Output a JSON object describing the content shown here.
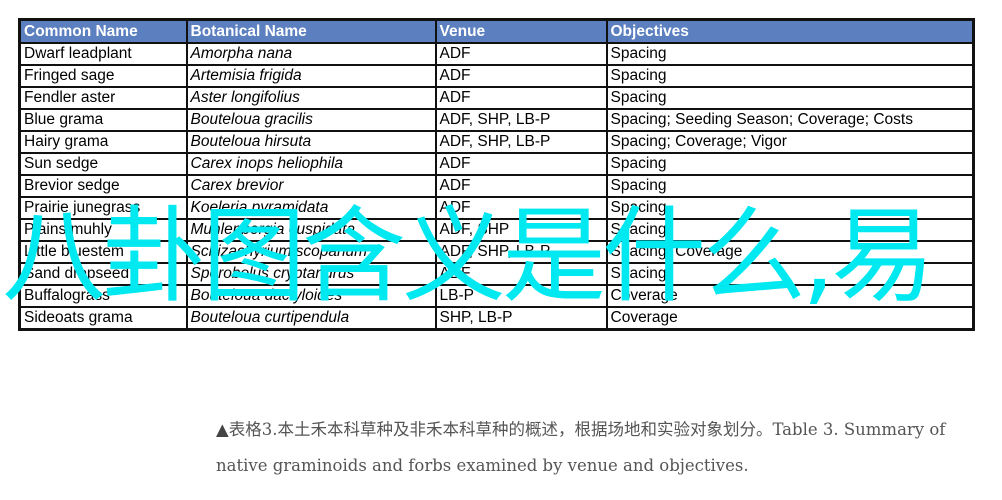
{
  "table": {
    "headers": [
      "Common Name",
      "Botanical  Name",
      "Venue",
      "Objectives"
    ],
    "header_bg": "#5b7fbf",
    "rows": [
      [
        "Dwarf leadplant",
        "Amorpha nana",
        "ADF",
        "Spacing"
      ],
      [
        "Fringed sage",
        "Artemisia frigida",
        "ADF",
        "Spacing"
      ],
      [
        "Fendler aster",
        "Aster longifolius",
        "ADF",
        "Spacing"
      ],
      [
        "Blue grama",
        "Bouteloua gracilis",
        "ADF, SHP, LB-P",
        "Spacing; Seeding Season;  Coverage; Costs"
      ],
      [
        "Hairy grama",
        "Bouteloua hirsuta",
        "ADF, SHP, LB-P",
        "Spacing; Coverage; Vigor"
      ],
      [
        "Sun sedge",
        "Carex inops heliophila",
        "ADF",
        "Spacing"
      ],
      [
        "Brevior sedge",
        "Carex brevior",
        "ADF",
        "Spacing"
      ],
      [
        "Prairie junegrass",
        "Koeleria pyramidata",
        "ADF",
        "Spacing"
      ],
      [
        "Plains muhly",
        "Muhlenbergia cuspidata",
        "ADF, SHP",
        "Spacing"
      ],
      [
        "Little bluestem",
        "Schizachyrium scoparium",
        "ADF, SHP, LB-P",
        "Spacing; Coverage"
      ],
      [
        "Sand dropseed",
        "Sporobolus cryptandrus",
        "ADF",
        "Spacing"
      ],
      [
        "Buffalograss",
        "Bouteloua dactyloides",
        "LB-P",
        "Coverage"
      ],
      [
        "Sideoats grama",
        "Bouteloua curtipendula",
        "SHP, LB-P",
        "Coverage"
      ]
    ]
  },
  "watermark": {
    "text": "八卦图含义是什么,易",
    "color": "#00e8f0"
  },
  "caption": {
    "marker": "▲",
    "text": "表格3.本土禾本科草种及非禾本科草种的概述，根据场地和实验对象划分。Table 3. Summary of native graminoids and forbs examined by venue and objectives."
  }
}
